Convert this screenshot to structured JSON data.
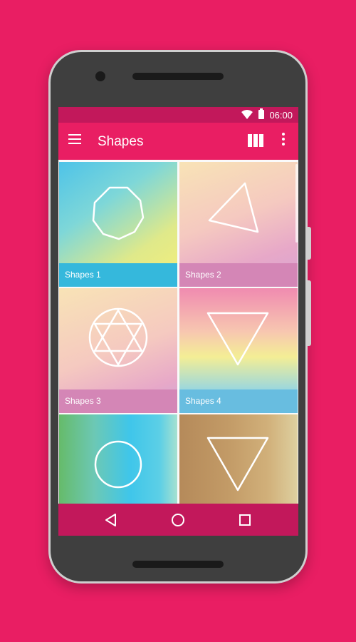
{
  "status_bar": {
    "time": "06:00",
    "icons": [
      "wifi-icon",
      "battery-icon"
    ]
  },
  "toolbar": {
    "title": "Shapes",
    "menu_icon": "hamburger-menu-icon",
    "view_toggle_icon": "column-view-icon",
    "overflow_icon": "more-vert-icon"
  },
  "gallery": {
    "items": [
      {
        "label": "Shapes 1",
        "shape": "octagon"
      },
      {
        "label": "Shapes 2",
        "shape": "triangle"
      },
      {
        "label": "Shapes 3",
        "shape": "hexagram-in-circle"
      },
      {
        "label": "Shapes 4",
        "shape": "inverted-triangle"
      },
      {
        "label": "",
        "shape": "circle"
      },
      {
        "label": "",
        "shape": "inverted-triangle"
      }
    ]
  },
  "nav_bar": {
    "icons": [
      "back-icon",
      "home-icon",
      "recents-icon"
    ]
  },
  "colors": {
    "background": "#e91e63",
    "status_bar": "#c2185b",
    "toolbar": "#e91e63",
    "nav_bar": "#c2185b"
  }
}
